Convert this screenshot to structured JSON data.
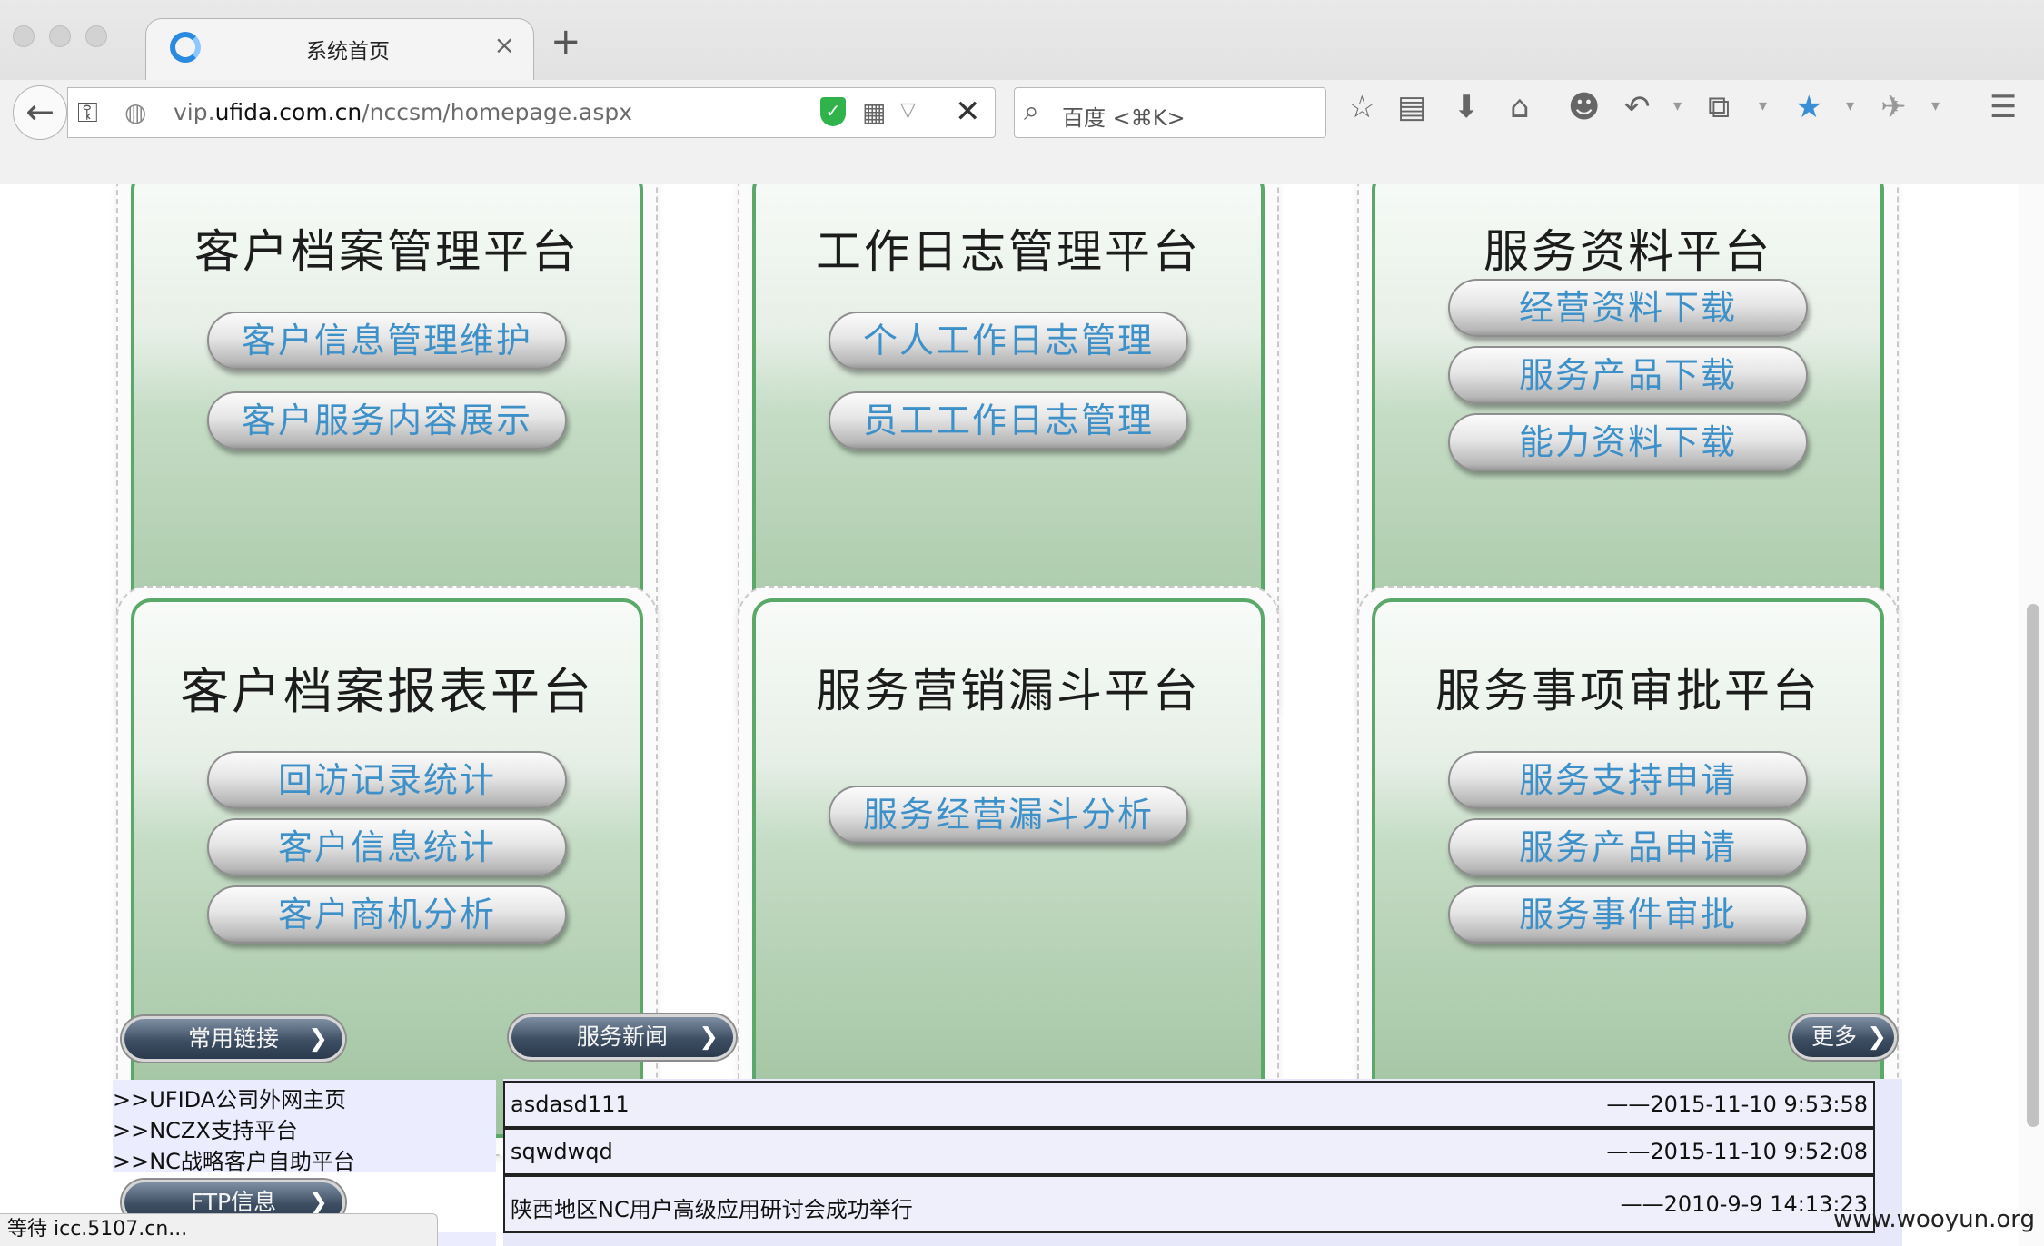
{
  "browser": {
    "tab_title": "系统首页",
    "tab_close": "×",
    "new_tab": "+",
    "url_host_prefix": "vip.",
    "url_host_main": "ufida.com.cn",
    "url_path": "/nccsm/homepage.aspx",
    "search_placeholder": "百度 <⌘K>",
    "icons": {
      "back": "←",
      "key": "⚿",
      "globe": "◍",
      "shield": "✓",
      "qr": "▦",
      "dropdown": "▽",
      "stop": "✕",
      "search": "⌕",
      "star": "☆",
      "reading_list": "▤",
      "download": "⬇",
      "home": "⌂",
      "chat": "☻",
      "undo": "↶",
      "crop": "⧉",
      "addon": "★",
      "extension": "✈",
      "menu": "☰",
      "arrow_small": "▾"
    }
  },
  "platforms": [
    {
      "title": "客户档案管理平台",
      "buttons": [
        "客户信息管理维护",
        "客户服务内容展示"
      ]
    },
    {
      "title": "工作日志管理平台",
      "buttons": [
        "个人工作日志管理",
        "员工工作日志管理"
      ]
    },
    {
      "title": "服务资料平台",
      "buttons": [
        "经营资料下载",
        "服务产品下载",
        "能力资料下载"
      ]
    },
    {
      "title": "客户档案报表平台",
      "buttons": [
        "回访记录统计",
        "客户信息统计",
        "客户商机分析"
      ]
    },
    {
      "title": "服务营销漏斗平台",
      "buttons": [
        "服务经营漏斗分析"
      ]
    },
    {
      "title": "服务事项审批平台",
      "buttons": [
        "服务支持申请",
        "服务产品申请",
        "服务事件审批"
      ]
    }
  ],
  "sections": {
    "common_links_label": "常用链接",
    "service_news_label": "服务新闻",
    "more_label": "更多",
    "ftp_label": "FTP信息",
    "chevron": "❯"
  },
  "common_links": [
    ">>UFIDA公司外网主页",
    ">>NCZX支持平台",
    ">>NC战略客户自助平台"
  ],
  "news": [
    {
      "title": "asdasd111",
      "date": "——2015-11-10 9:53:58"
    },
    {
      "title": "sqwdwqd",
      "date": "——2015-11-10 9:52:08"
    },
    {
      "title": "陕西地区NC用户高级应用研讨会成功举行",
      "date": "——2010-9-9 14:13:23"
    }
  ],
  "status": {
    "text": "等待 icc.5107.cn..."
  },
  "watermark": "www.wooyun.org",
  "colors": {
    "card_border": "#5aa86a",
    "pill_text": "#3d90c8",
    "section_btn": "#3d4e63",
    "news_bg": "#e8e8fb"
  }
}
